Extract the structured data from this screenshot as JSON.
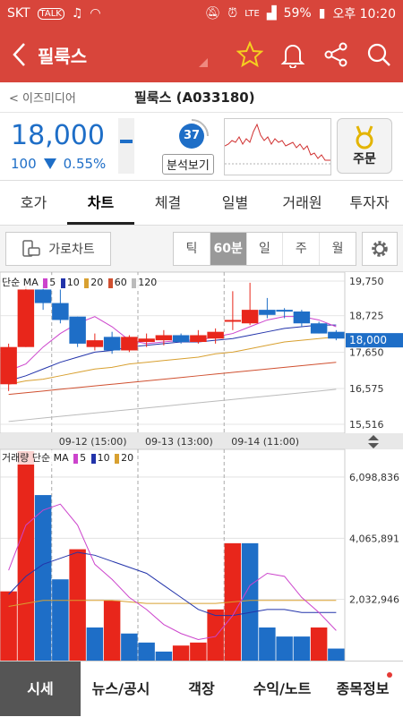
{
  "status": {
    "carrier": "SKT",
    "battery": "59%",
    "time": "오후 10:20",
    "network": "LTE"
  },
  "appbar": {
    "title": "필룩스"
  },
  "crumb": {
    "source": "< 이즈미디어",
    "name": "필룩스 (A033180)"
  },
  "quote": {
    "price": "18,000",
    "change": "100",
    "rate": "0.55%",
    "direction": "down",
    "score": "37",
    "analyze_label": "분석보기",
    "order_label": "주문"
  },
  "tabs": [
    "호가",
    "차트",
    "체결",
    "일별",
    "거래원",
    "투자자"
  ],
  "active_tab": "차트",
  "controls": {
    "landscape_label": "가로차트",
    "periods": [
      "틱",
      "60분",
      "일",
      "주",
      "월"
    ],
    "active_period": "60분"
  },
  "price_legend": {
    "prefix": "단순 MA",
    "periods": [
      "5",
      "10",
      "20",
      "60",
      "120"
    ],
    "colors": [
      "#cc44cc",
      "#2233aa",
      "#d8a030",
      "#d05030",
      "#bbbbbb"
    ]
  },
  "volume_legend": {
    "title": "거래량",
    "prefix": "단순 MA",
    "periods": [
      "5",
      "10",
      "20"
    ]
  },
  "price_axis": [
    "19,750",
    "18,725",
    "17,650",
    "16,575",
    "15,516"
  ],
  "current_price_tag": "18,000",
  "time_labels": [
    "09-12 (15:00)",
    "09-13 (13:00)",
    "09-14 (11:00)"
  ],
  "volume_axis": [
    "6,098,836",
    "4,065,891",
    "2,032,946"
  ],
  "bottom_nav": [
    "시세",
    "뉴스/공시",
    "객장",
    "수익/노트",
    "종목정보"
  ],
  "active_nav": "시세",
  "colors": {
    "header": "#d8453b",
    "up": "#e8261b",
    "down": "#1e6ec7"
  },
  "chart_data": [
    {
      "type": "candlestick",
      "ylim": [
        15516,
        19750
      ],
      "yticks": [
        19750,
        18725,
        17650,
        16575,
        15516
      ],
      "candles": [
        {
          "o": 16700,
          "h": 17900,
          "l": 16500,
          "c": 17800
        },
        {
          "o": 17800,
          "h": 19600,
          "l": 17800,
          "c": 19500
        },
        {
          "o": 19500,
          "h": 19650,
          "l": 18900,
          "c": 19100
        },
        {
          "o": 19100,
          "h": 19500,
          "l": 18500,
          "c": 18600
        },
        {
          "o": 18700,
          "h": 18700,
          "l": 17800,
          "c": 17900
        },
        {
          "o": 17800,
          "h": 18200,
          "l": 17700,
          "c": 18000
        },
        {
          "o": 18100,
          "h": 18250,
          "l": 17600,
          "c": 17700
        },
        {
          "o": 17700,
          "h": 18150,
          "l": 17650,
          "c": 18100
        },
        {
          "o": 17950,
          "h": 18200,
          "l": 17800,
          "c": 18050
        },
        {
          "o": 18000,
          "h": 18300,
          "l": 17850,
          "c": 18150
        },
        {
          "o": 18150,
          "h": 18200,
          "l": 17900,
          "c": 17950
        },
        {
          "o": 17950,
          "h": 18300,
          "l": 17900,
          "c": 18150
        },
        {
          "o": 18050,
          "h": 18350,
          "l": 17900,
          "c": 18250
        },
        {
          "o": 18550,
          "h": 19450,
          "l": 18300,
          "c": 18600
        },
        {
          "o": 18500,
          "h": 19700,
          "l": 18450,
          "c": 18900
        },
        {
          "o": 18900,
          "h": 19250,
          "l": 18650,
          "c": 18750
        },
        {
          "o": 18900,
          "h": 18950,
          "l": 18650,
          "c": 18850
        },
        {
          "o": 18850,
          "h": 18900,
          "l": 18400,
          "c": 18500
        },
        {
          "o": 18500,
          "h": 18550,
          "l": 18200,
          "c": 18200
        },
        {
          "o": 18250,
          "h": 18300,
          "l": 18000,
          "c": 18050
        }
      ],
      "ma5": [
        17100,
        17300,
        17800,
        18200,
        18500,
        18700,
        18400,
        18000,
        17900,
        17950,
        18000,
        18000,
        18100,
        18200,
        18400,
        18600,
        18700,
        18700,
        18600,
        18400
      ],
      "ma10": [
        16800,
        16950,
        17150,
        17350,
        17500,
        17650,
        17700,
        17800,
        17850,
        17900,
        17950,
        17950,
        18000,
        18050,
        18150,
        18250,
        18350,
        18400,
        18450,
        18450
      ],
      "ma20": [
        16700,
        16800,
        16850,
        16950,
        17050,
        17150,
        17200,
        17300,
        17350,
        17400,
        17450,
        17500,
        17600,
        17650,
        17750,
        17850,
        17950,
        18000,
        18050,
        18100
      ],
      "ma60": [
        16400,
        16450,
        16500,
        16550,
        16600,
        16650,
        16700,
        16750,
        16800,
        16850,
        16900,
        16950,
        17000,
        17050,
        17100,
        17150,
        17200,
        17250,
        17300,
        17350
      ],
      "ma120": [
        15600,
        15650,
        15700,
        15750,
        15800,
        15850,
        15900,
        15950,
        16000,
        16050,
        16100,
        16150,
        16200,
        16250,
        16300,
        16350,
        16400,
        16450,
        16500,
        16550
      ]
    },
    {
      "type": "bar",
      "title": "거래량",
      "ylim": [
        0,
        6900000
      ],
      "yticks": [
        6098836,
        4065891,
        2032946
      ],
      "values": [
        2300000,
        8000000,
        5500000,
        2700000,
        3700000,
        1100000,
        2000000,
        900000,
        600000,
        300000,
        500000,
        600000,
        1700000,
        3900000,
        3900000,
        1100000,
        800000,
        800000,
        1100000,
        400000
      ],
      "up": [
        true,
        true,
        false,
        false,
        true,
        false,
        true,
        false,
        false,
        false,
        true,
        true,
        true,
        true,
        false,
        false,
        false,
        false,
        true,
        false
      ],
      "ma5": [
        3000000,
        4500000,
        5000000,
        5200000,
        4500000,
        3200000,
        2700000,
        2100000,
        1700000,
        1200000,
        900000,
        700000,
        800000,
        1500000,
        2500000,
        2900000,
        2800000,
        2100000,
        1600000,
        1000000
      ],
      "ma10": [
        2200000,
        2800000,
        3200000,
        3400000,
        3600000,
        3500000,
        3300000,
        3100000,
        2900000,
        2500000,
        2100000,
        1700000,
        1500000,
        1500000,
        1600000,
        1700000,
        1700000,
        1600000,
        1600000,
        1600000
      ],
      "ma20": [
        1800000,
        1900000,
        2000000,
        2000000,
        2000000,
        2000000,
        2000000,
        1950000,
        1900000,
        1900000,
        1900000,
        1900000,
        1900000,
        1950000,
        2000000,
        2000000,
        2000000,
        2000000,
        2000000,
        2000000
      ]
    }
  ]
}
